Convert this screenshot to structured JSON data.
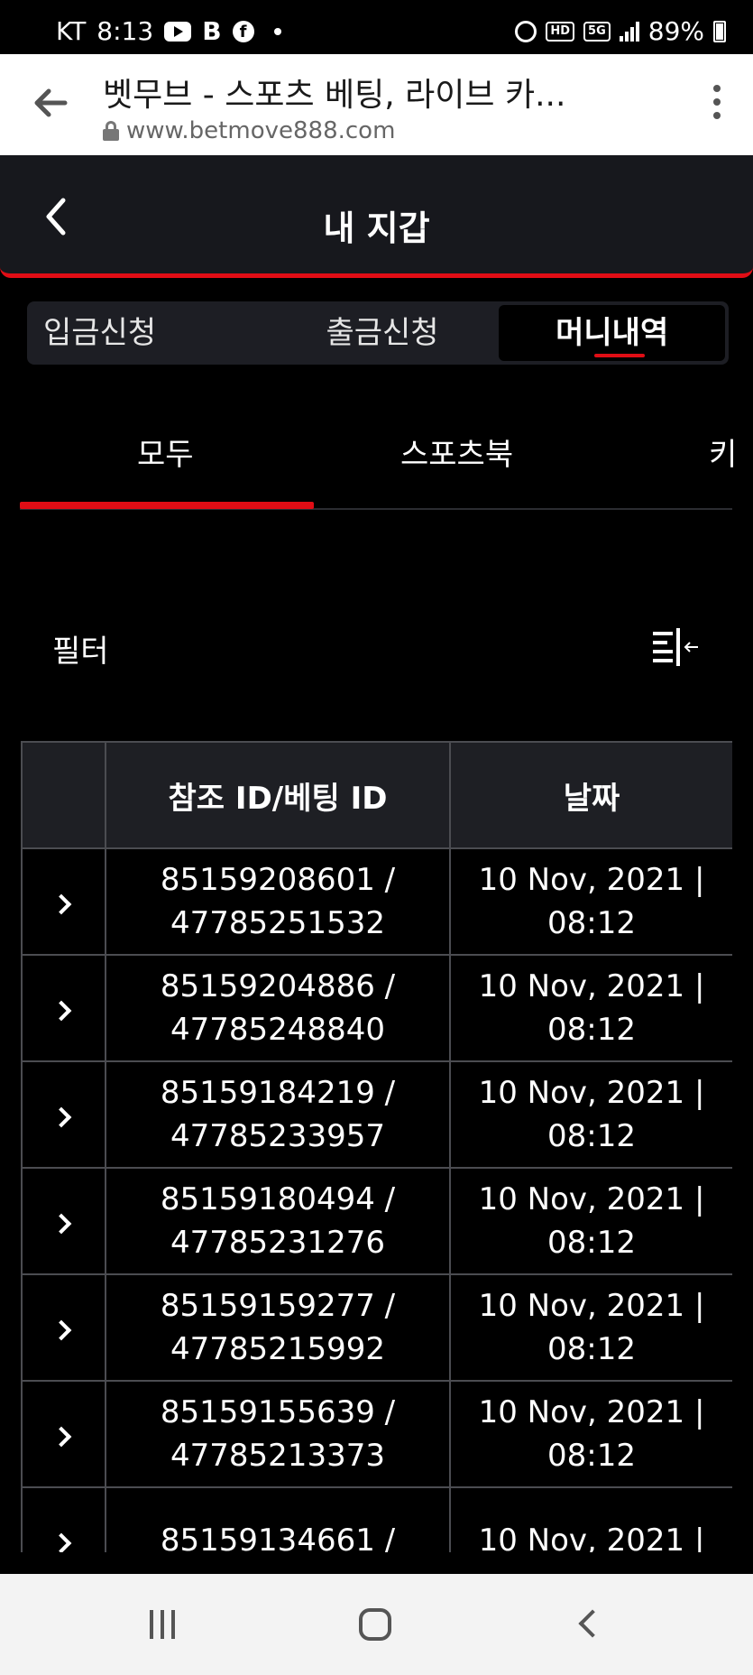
{
  "status_bar": {
    "carrier": "KT",
    "time": "8:13",
    "battery": "89%",
    "badge_hd": "HD",
    "badge_5g": "5G",
    "icons": [
      "youtube-icon",
      "b-icon",
      "facebook-icon",
      "dot-icon",
      "alarm-icon",
      "signal-icon",
      "battery-icon"
    ]
  },
  "browser": {
    "page_title": "벳무브 - 스포츠 베팅, 라이브 카...",
    "url": "www.betmove888.com"
  },
  "header": {
    "title": "내 지갑"
  },
  "segments": [
    {
      "label": "입금신청",
      "active": false
    },
    {
      "label": "출금신청",
      "active": false
    },
    {
      "label": "머니내역",
      "active": true
    }
  ],
  "subtabs": [
    {
      "label": "모두",
      "active": true
    },
    {
      "label": "스포츠북",
      "active": false
    },
    {
      "label": "키",
      "active": false
    }
  ],
  "filter": {
    "label": "필터"
  },
  "table": {
    "headers": [
      "",
      "참조 ID/베팅 ID",
      "날짜"
    ],
    "rows": [
      {
        "ref": "85159208601 /",
        "bet": "47785251532",
        "date": "10 Nov, 2021 |",
        "time": "08:12"
      },
      {
        "ref": "85159204886 /",
        "bet": "47785248840",
        "date": "10 Nov, 2021 |",
        "time": "08:12"
      },
      {
        "ref": "85159184219 /",
        "bet": "47785233957",
        "date": "10 Nov, 2021 |",
        "time": "08:12"
      },
      {
        "ref": "85159180494 /",
        "bet": "47785231276",
        "date": "10 Nov, 2021 |",
        "time": "08:12"
      },
      {
        "ref": "85159159277 /",
        "bet": "47785215992",
        "date": "10 Nov, 2021 |",
        "time": "08:12"
      },
      {
        "ref": "85159155639 /",
        "bet": "47785213373",
        "date": "10 Nov, 2021 |",
        "time": "08:12"
      },
      {
        "ref": "85159134661 /",
        "bet": "",
        "date": "10 Nov, 2021 |",
        "time": ""
      }
    ]
  },
  "colors": {
    "accent": "#e00d15",
    "background": "#000000",
    "header_bg": "#17181d",
    "table_border": "#4b4c51"
  }
}
